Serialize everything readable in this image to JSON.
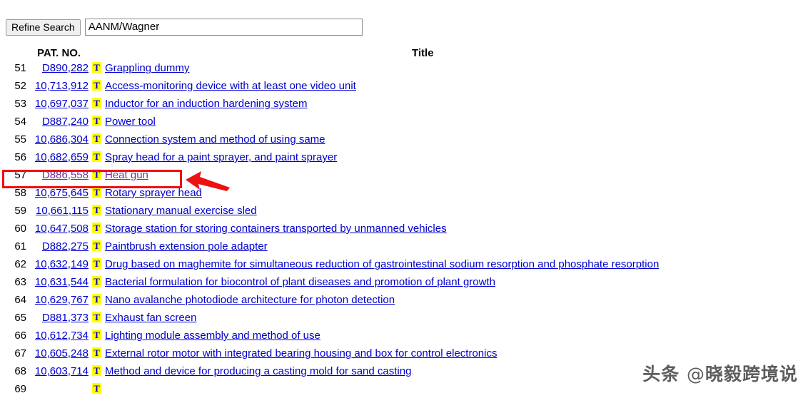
{
  "search": {
    "refine_label": "Refine Search",
    "query_value": "AANM/Wagner",
    "placeholder": ""
  },
  "table": {
    "headers": {
      "number": "",
      "pat_no": "PAT. NO.",
      "title": "Title"
    },
    "rows": [
      {
        "num": "51",
        "pat": "D890,282",
        "t_icon": "T",
        "title": "Grappling dummy",
        "visited": false
      },
      {
        "num": "52",
        "pat": "10,713,912",
        "t_icon": "T",
        "title": "Access-monitoring device with at least one video unit",
        "visited": false
      },
      {
        "num": "53",
        "pat": "10,697,037",
        "t_icon": "T",
        "title": "Inductor for an induction hardening system",
        "visited": false
      },
      {
        "num": "54",
        "pat": "D887,240",
        "t_icon": "T",
        "title": "Power tool",
        "visited": false
      },
      {
        "num": "55",
        "pat": "10,686,304",
        "t_icon": "T",
        "title": "Connection system and method of using same",
        "visited": false
      },
      {
        "num": "56",
        "pat": "10,682,659",
        "t_icon": "T",
        "title": "Spray head for a paint sprayer, and paint sprayer",
        "visited": false
      },
      {
        "num": "57",
        "pat": "D886,558",
        "t_icon": "T",
        "title": "Heat gun",
        "visited": true
      },
      {
        "num": "58",
        "pat": "10,675,645",
        "t_icon": "T",
        "title": "Rotary sprayer head",
        "visited": false
      },
      {
        "num": "59",
        "pat": "10,661,115",
        "t_icon": "T",
        "title": "Stationary manual exercise sled",
        "visited": false
      },
      {
        "num": "60",
        "pat": "10,647,508",
        "t_icon": "T",
        "title": "Storage station for storing containers transported by unmanned vehicles",
        "visited": false
      },
      {
        "num": "61",
        "pat": "D882,275",
        "t_icon": "T",
        "title": "Paintbrush extension pole adapter",
        "visited": false
      },
      {
        "num": "62",
        "pat": "10,632,149",
        "t_icon": "T",
        "title": "Drug based on maghemite for simultaneous reduction of gastrointestinal sodium resorption and phosphate resorption",
        "visited": false
      },
      {
        "num": "63",
        "pat": "10,631,544",
        "t_icon": "T",
        "title": "Bacterial formulation for biocontrol of plant diseases and promotion of plant growth",
        "visited": false
      },
      {
        "num": "64",
        "pat": "10,629,767",
        "t_icon": "T",
        "title": "Nano avalanche photodiode architecture for photon detection",
        "visited": false
      },
      {
        "num": "65",
        "pat": "D881,373",
        "t_icon": "T",
        "title": "Exhaust fan screen",
        "visited": false
      },
      {
        "num": "66",
        "pat": "10,612,734",
        "t_icon": "T",
        "title": "Lighting module assembly and method of use",
        "visited": false
      },
      {
        "num": "67",
        "pat": "10,605,248",
        "t_icon": "T",
        "title": "External rotor motor with integrated bearing housing and box for control electronics",
        "visited": false
      },
      {
        "num": "68",
        "pat": "10,603,714",
        "t_icon": "T",
        "title": "Method and device for producing a casting mold for sand casting",
        "visited": false
      },
      {
        "num": "69",
        "pat": "",
        "t_icon": "T",
        "title": "",
        "visited": false
      }
    ]
  },
  "annotation": {
    "highlight_row_index": 6,
    "box_color": "#ee1111",
    "arrow_color": "#ee1111"
  },
  "watermark": {
    "prefix": "头条",
    "at": "@",
    "handle": "晓毅跨境说"
  },
  "colors": {
    "link": "#0000cc",
    "link_visited": "#7a2d8f",
    "badge_bg": "#ffff00",
    "badge_fg": "#0000cc",
    "annotation_red": "#ee1111"
  }
}
